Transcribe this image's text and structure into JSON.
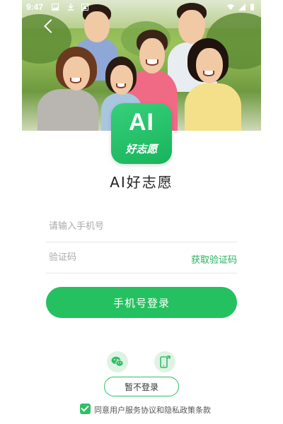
{
  "status_bar": {
    "time": "9:47"
  },
  "logo": {
    "mark": "AI",
    "subtitle": "好志愿"
  },
  "app_name": "AI好志愿",
  "form": {
    "phone_placeholder": "请输入手机号",
    "code_placeholder": "验证码",
    "get_code_label": "获取验证码",
    "login_label": "手机号登录"
  },
  "third_party": [
    {
      "icon": "wechat-icon"
    },
    {
      "icon": "phone-login-icon"
    }
  ],
  "skip_label": "暂不登录",
  "agreement": {
    "prefix": "同意",
    "user_service": "用户服务协议",
    "and": "和",
    "privacy": "隐私政策条款",
    "checked": true
  },
  "colors": {
    "brand_green": "#25c05f",
    "link_green": "#22b35a"
  }
}
